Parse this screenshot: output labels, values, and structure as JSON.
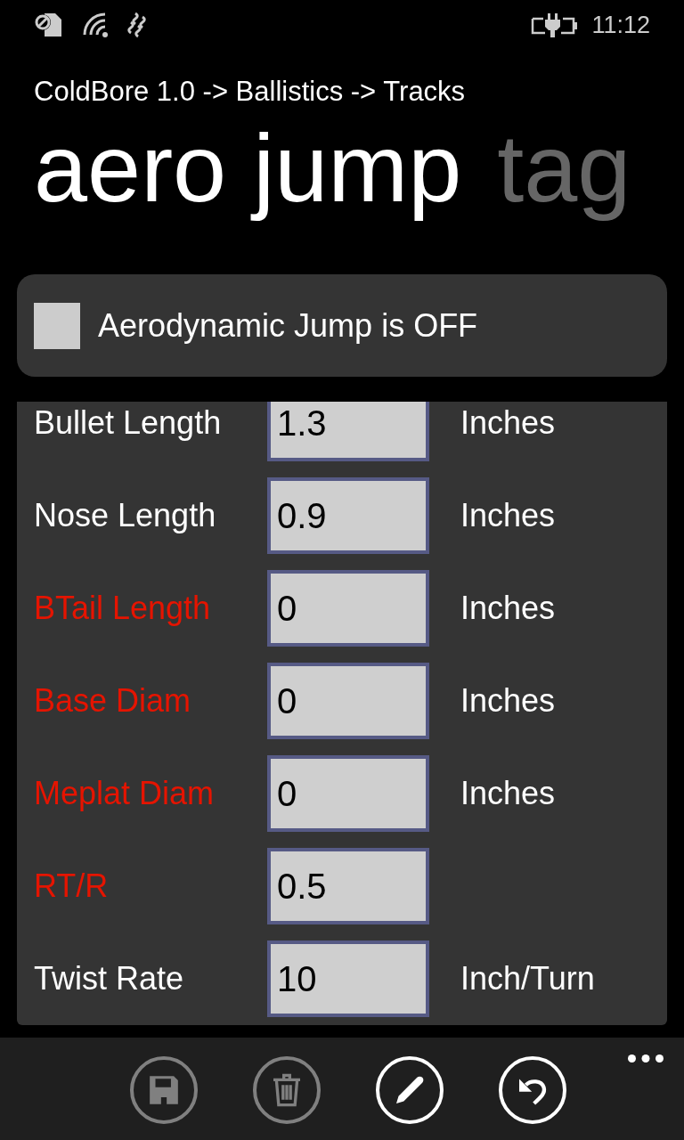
{
  "status_bar": {
    "time": "11:12"
  },
  "breadcrumb": "ColdBore 1.0 -> Ballistics -> Tracks",
  "pivot": [
    {
      "label": "aero jump",
      "selected": true
    },
    {
      "label": "tag",
      "selected": false
    }
  ],
  "toggle": {
    "label": "Aerodynamic Jump is OFF",
    "checked": false
  },
  "fields": [
    {
      "label": "Bullet Length",
      "value": "1.3",
      "unit": "Inches",
      "color": "#ffffff"
    },
    {
      "label": "Nose Length",
      "value": "0.9",
      "unit": "Inches",
      "color": "#ffffff"
    },
    {
      "label": "BTail Length",
      "value": "0",
      "unit": "Inches",
      "color": "#e51400"
    },
    {
      "label": "Base Diam",
      "value": "0",
      "unit": "Inches",
      "color": "#e51400"
    },
    {
      "label": "Meplat Diam",
      "value": "0",
      "unit": "Inches",
      "color": "#e51400"
    },
    {
      "label": "RT/R",
      "value": "0.5",
      "color": "#e51400"
    },
    {
      "label": "Twist Rate",
      "value": "10",
      "unit": "Inch/Turn",
      "color": "#ffffff"
    }
  ],
  "app_bar": {
    "buttons": [
      {
        "disabled": true
      },
      {
        "disabled": true
      },
      {
        "disabled": false
      },
      {
        "disabled": false
      }
    ]
  }
}
